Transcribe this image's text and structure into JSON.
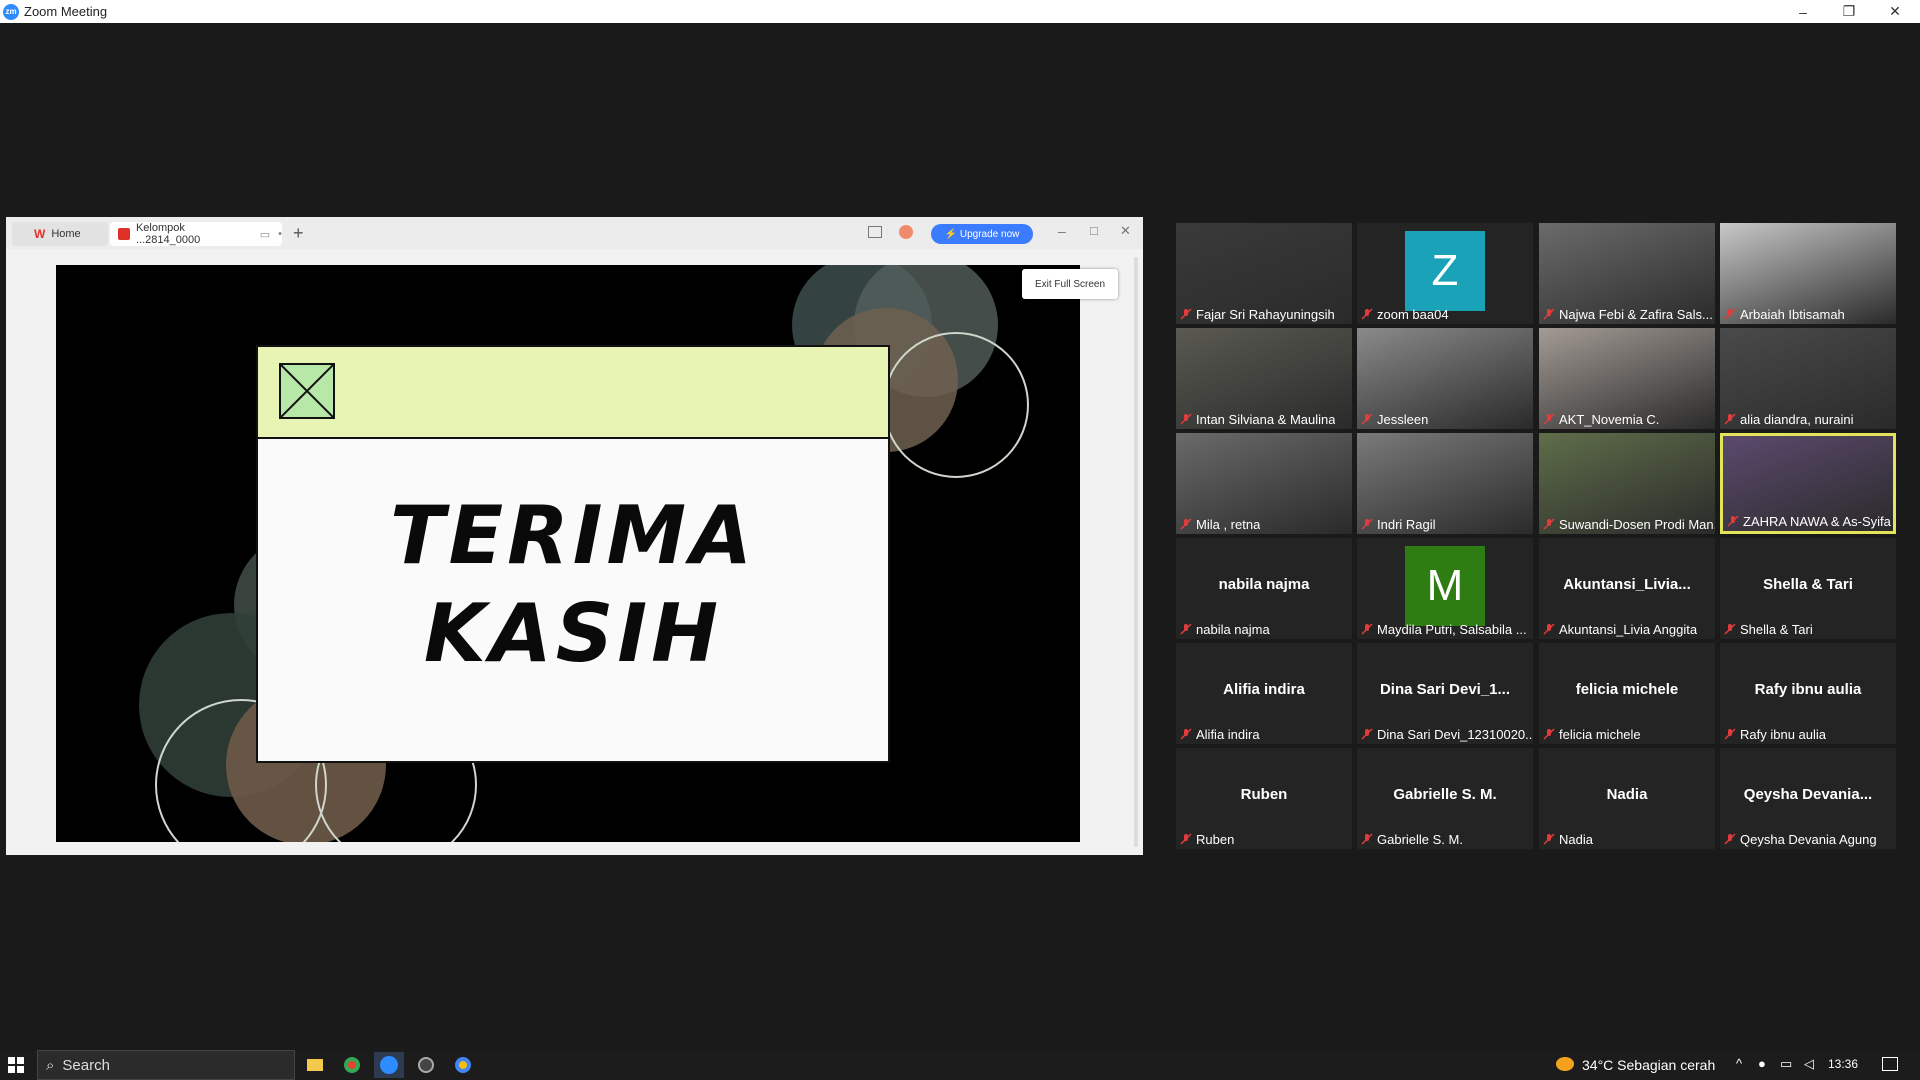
{
  "window": {
    "title": "Zoom Meeting",
    "controls": {
      "minimize": "–",
      "restore": "❐",
      "close": "✕"
    }
  },
  "share": {
    "tabs": [
      {
        "label": "Home",
        "icon": "wps-logo-icon"
      },
      {
        "label": "Kelompok ...2814_0000",
        "icon": "presentation-icon"
      }
    ],
    "upgrade_label": "⚡ Upgrade now",
    "exit_fullscreen_label": "Exit Full Screen",
    "slide": {
      "line1": "TERIMA",
      "line2": "KASIH"
    },
    "accent_colors": {
      "header": "#e7f4b4",
      "xbox": "#b8e8a8"
    }
  },
  "participants": [
    {
      "name": "Fajar Sri Rahayuningsih",
      "type": "video"
    },
    {
      "name": "zoom baa04",
      "type": "avatar",
      "letter": "Z",
      "color": "#1aa2b8"
    },
    {
      "name": "Najwa Febi & Zafira Sals...",
      "type": "video"
    },
    {
      "name": "Arbaiah Ibtisamah",
      "type": "video"
    },
    {
      "name": "Intan Silviana & Maulina",
      "type": "video"
    },
    {
      "name": "Jessleen",
      "type": "video"
    },
    {
      "name": "AKT_Novemia C.",
      "type": "video"
    },
    {
      "name": "alia diandra, nuraini",
      "type": "video"
    },
    {
      "name": "Mila , retna",
      "type": "video"
    },
    {
      "name": "Indri Ragil",
      "type": "video"
    },
    {
      "name": "Suwandi-Dosen Prodi Man...",
      "type": "video"
    },
    {
      "name": "ZAHRA NAWA & As-Syifa",
      "type": "video",
      "active": true
    },
    {
      "name": "nabila najma",
      "big": "nabila najma",
      "type": "text"
    },
    {
      "name": "Maydila Putri, Salsabila ...",
      "type": "avatar",
      "letter": "M",
      "color": "#2e7d12"
    },
    {
      "name": "Akuntansi_Livia Anggita",
      "big": "Akuntansi_Livia...",
      "type": "text"
    },
    {
      "name": "Shella & Tari",
      "big": "Shella & Tari",
      "type": "text"
    },
    {
      "name": "Alifia indira",
      "big": "Alifia indira",
      "type": "text"
    },
    {
      "name": "Dina Sari Devi_12310020...",
      "big": "Dina Sari Devi_1...",
      "type": "text"
    },
    {
      "name": "felicia michele",
      "big": "felicia michele",
      "type": "text"
    },
    {
      "name": "Rafy ibnu aulia",
      "big": "Rafy ibnu aulia",
      "type": "text"
    },
    {
      "name": "Ruben",
      "big": "Ruben",
      "type": "text"
    },
    {
      "name": "Gabrielle S. M.",
      "big": "Gabrielle S. M.",
      "type": "text"
    },
    {
      "name": "Nadia",
      "big": "Nadia",
      "type": "text"
    },
    {
      "name": "Qeysha Devania Agung",
      "big": "Qeysha Devania...",
      "type": "text"
    }
  ],
  "taskbar": {
    "search_placeholder": "Search",
    "weather": "34°C  Sebagian cerah",
    "time": "13:36"
  }
}
